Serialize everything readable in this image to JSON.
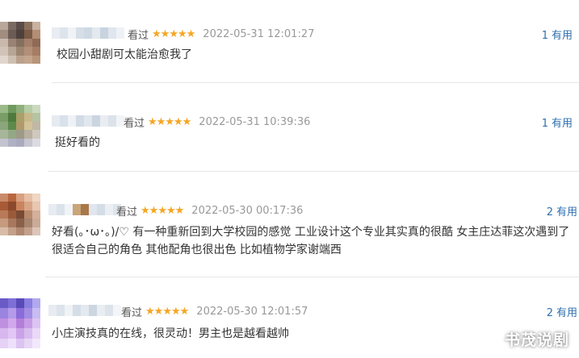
{
  "reviews": [
    {
      "watched_label": "看过",
      "stars": "★★★★★",
      "date": "2022-05-31 12:01:27",
      "useful_count": "1",
      "useful_label": "有用",
      "content": "校园小甜剧可太能治愈我了",
      "avatar_colors": [
        "#b8a79a",
        "#7a6a62",
        "#5a4c48",
        "#8b6f5d",
        "#c8b2a0",
        "#a08d80",
        "#6b5b55",
        "#4e413d",
        "#7b5a46",
        "#b38e74",
        "#c9b9ad",
        "#9a8375",
        "#85705f",
        "#a4806a",
        "#8f6a55",
        "#d1c3b8",
        "#b7a596",
        "#9c8570",
        "#b38f78",
        "#a67c64",
        "#e0d6ce",
        "#cdbfb2",
        "#b9a18e",
        "#c4a58e",
        "#b89478"
      ],
      "name_colors": [
        "#e8edf3",
        "#dde4ec",
        "#f0f3f6",
        "#d6dee8",
        "#cfd9e4",
        "#e3e9ef",
        "#c9d3df",
        "#dfe6ee",
        "#eef2f6"
      ]
    },
    {
      "watched_label": "看过",
      "stars": "★★★★★",
      "date": "2022-05-31 10:39:36",
      "useful_count": "1",
      "useful_label": "有用",
      "content": "挺好看的",
      "avatar_colors": [
        "#9cb98a",
        "#6f9a5d",
        "#8fb07c",
        "#b6cca6",
        "#cbd9c0",
        "#7a9d68",
        "#4f7a3e",
        "#a9a06a",
        "#c7b98a",
        "#b5c3a3",
        "#8aa67a",
        "#5e8a4c",
        "#b09a6a",
        "#d2c39a",
        "#c0b7a5",
        "#a7b59a",
        "#93a884",
        "#9d9a88",
        "#b8b0a0",
        "#cfc8bc",
        "#c3c3cf",
        "#b0b0c4",
        "#aaaabf",
        "#c8c6d2",
        "#dcdae3"
      ],
      "name_colors": [
        "#e6ebf1",
        "#d9e1ea",
        "#eef1f5",
        "#d2dbe6",
        "#e1e7ee",
        "#cbd5e0",
        "#e9edf2",
        "#dbe2ea",
        "#f2f4f7"
      ]
    },
    {
      "watched_label": "看过",
      "stars": "★★★★★",
      "date": "2022-05-30 00:17:36",
      "useful_count": "2",
      "useful_label": "有用",
      "content": "好看(｡･ω･｡)/♡ 有一种重新回到大学校园的感觉 工业设计这个专业其实真的很酷 女主庄达菲这次遇到了很适合自己的角色 其他配角也很出色 比如植物学家谢端西",
      "avatar_colors": [
        "#c98a6a",
        "#b8663f",
        "#d9a080",
        "#e6c0a6",
        "#f0d6c4",
        "#a85a36",
        "#8c4a2c",
        "#c9845e",
        "#d8a585",
        "#e7c7b0",
        "#b87a58",
        "#9a5a3c",
        "#7a4a34",
        "#b88a6c",
        "#d4b09a",
        "#c69a7e",
        "#a8785e",
        "#8a6048",
        "#a6846e",
        "#c9ab98",
        "#d8bca8",
        "#c4a08a",
        "#b08870",
        "#c2a08c",
        "#dcc6b8"
      ],
      "name_colors": [
        "#e7ecf2",
        "#dbe2ea",
        "#f1f4f7",
        "#c9a57a",
        "#a8784a",
        "#e0e6ed",
        "#d4dce6",
        "#ebeff4",
        "#dfe5ec"
      ]
    },
    {
      "watched_label": "看过",
      "stars": "★★★★★",
      "date": "2022-05-30 12:01:57",
      "useful_count": "2",
      "useful_label": "有用",
      "content": "小庄演技真的在线，很灵动！男主也是越看越帅",
      "avatar_colors": [
        "#6a5ac8",
        "#7e6fd6",
        "#5a4ab8",
        "#8a7ee0",
        "#b2a8ee",
        "#9a84e0",
        "#b49ae8",
        "#8a6cd8",
        "#a28ce4",
        "#c8bcf2",
        "#c090e0",
        "#d2a8ec",
        "#b47ed8",
        "#c89ce6",
        "#dcc4f2",
        "#d8b6ee",
        "#e2c6f4",
        "#caa2e8",
        "#d8bcf0",
        "#ead8f8",
        "#e6d2f6",
        "#eee0fa",
        "#dcc4f2",
        "#e8d6f6",
        "#f2e8fb"
      ],
      "name_colors": [
        "#e8ecf2",
        "#dce3eb",
        "#f0f3f6",
        "#d5dde7",
        "#e4e9ef",
        "#ccd6e1",
        "#eaeef3",
        "#dde3eb",
        "#f3f5f8"
      ]
    }
  ],
  "watermark": "书茂说剧",
  "colors": {
    "star": "#f5a623",
    "link": "#2f6fb0",
    "date": "#999999",
    "divider": "#e6e6e6"
  }
}
